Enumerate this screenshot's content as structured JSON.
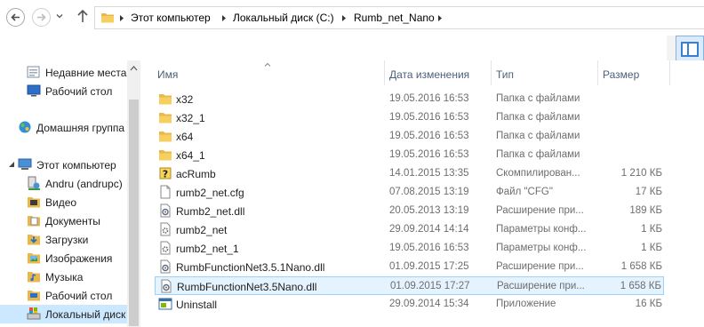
{
  "address": {
    "crumbs": [
      "Этот компьютер",
      "Локальный диск (C:)",
      "Rumb_net_Nano"
    ]
  },
  "navigation": {
    "items": [
      {
        "label": "Недавние места",
        "icon": "recent-places-icon"
      },
      {
        "label": "Рабочий стол",
        "icon": "desktop-icon"
      },
      {
        "label": "Домашняя группа",
        "icon": "homegroup-icon"
      },
      {
        "label": "Этот компьютер",
        "icon": "computer-icon"
      },
      {
        "label": "Andru (andrupc)",
        "icon": "user-icon"
      },
      {
        "label": "Видео",
        "icon": "videos-folder-icon"
      },
      {
        "label": "Документы",
        "icon": "documents-folder-icon"
      },
      {
        "label": "Загрузки",
        "icon": "downloads-folder-icon"
      },
      {
        "label": "Изображения",
        "icon": "pictures-folder-icon"
      },
      {
        "label": "Музыка",
        "icon": "music-folder-icon"
      },
      {
        "label": "Рабочий стол",
        "icon": "desktop-folder-icon"
      },
      {
        "label": "Локальный диск",
        "icon": "local-disk-icon"
      }
    ]
  },
  "columns": {
    "name": "Имя",
    "date": "Дата изменения",
    "type": "Тип",
    "size": "Размер"
  },
  "files": [
    {
      "name": "x32",
      "date": "19.05.2016 16:53",
      "type": "Папка с файлами",
      "size": "",
      "icon": "folder-icon"
    },
    {
      "name": "x32_1",
      "date": "19.05.2016 16:53",
      "type": "Папка с файлами",
      "size": "",
      "icon": "folder-icon"
    },
    {
      "name": "x64",
      "date": "19.05.2016 16:53",
      "type": "Папка с файлами",
      "size": "",
      "icon": "folder-icon"
    },
    {
      "name": "x64_1",
      "date": "19.05.2016 16:53",
      "type": "Папка с файлами",
      "size": "",
      "icon": "folder-icon"
    },
    {
      "name": "acRumb",
      "date": "14.01.2015 13:35",
      "type": "Скомпилирован...",
      "size": "1 210 КБ",
      "icon": "compiled-help-icon"
    },
    {
      "name": "rumb2_net.cfg",
      "date": "07.08.2015 13:19",
      "type": "Файл \"CFG\"",
      "size": "17 КБ",
      "icon": "blank-file-icon"
    },
    {
      "name": "Rumb2_net.dll",
      "date": "20.05.2013 13:19",
      "type": "Расширение при...",
      "size": "189 КБ",
      "icon": "dll-file-icon"
    },
    {
      "name": "rumb2_net",
      "date": "29.09.2014 14:14",
      "type": "Параметры конф...",
      "size": "1 КБ",
      "icon": "config-file-icon"
    },
    {
      "name": "rumb2_net_1",
      "date": "19.05.2016 16:53",
      "type": "Параметры конф...",
      "size": "1 КБ",
      "icon": "config-file-icon"
    },
    {
      "name": "RumbFunctionNet3.5.1Nano.dll",
      "date": "01.09.2015 17:25",
      "type": "Расширение при...",
      "size": "1 658 КБ",
      "icon": "dll-file-icon"
    },
    {
      "name": "RumbFunctionNet3.5Nano.dll",
      "date": "01.09.2015 17:27",
      "type": "Расширение при...",
      "size": "1 658 КБ",
      "icon": "dll-file-icon",
      "selected": true
    },
    {
      "name": "Uninstall",
      "date": "29.09.2014 15:34",
      "type": "Приложение",
      "size": "16 КБ",
      "icon": "application-icon"
    }
  ]
}
